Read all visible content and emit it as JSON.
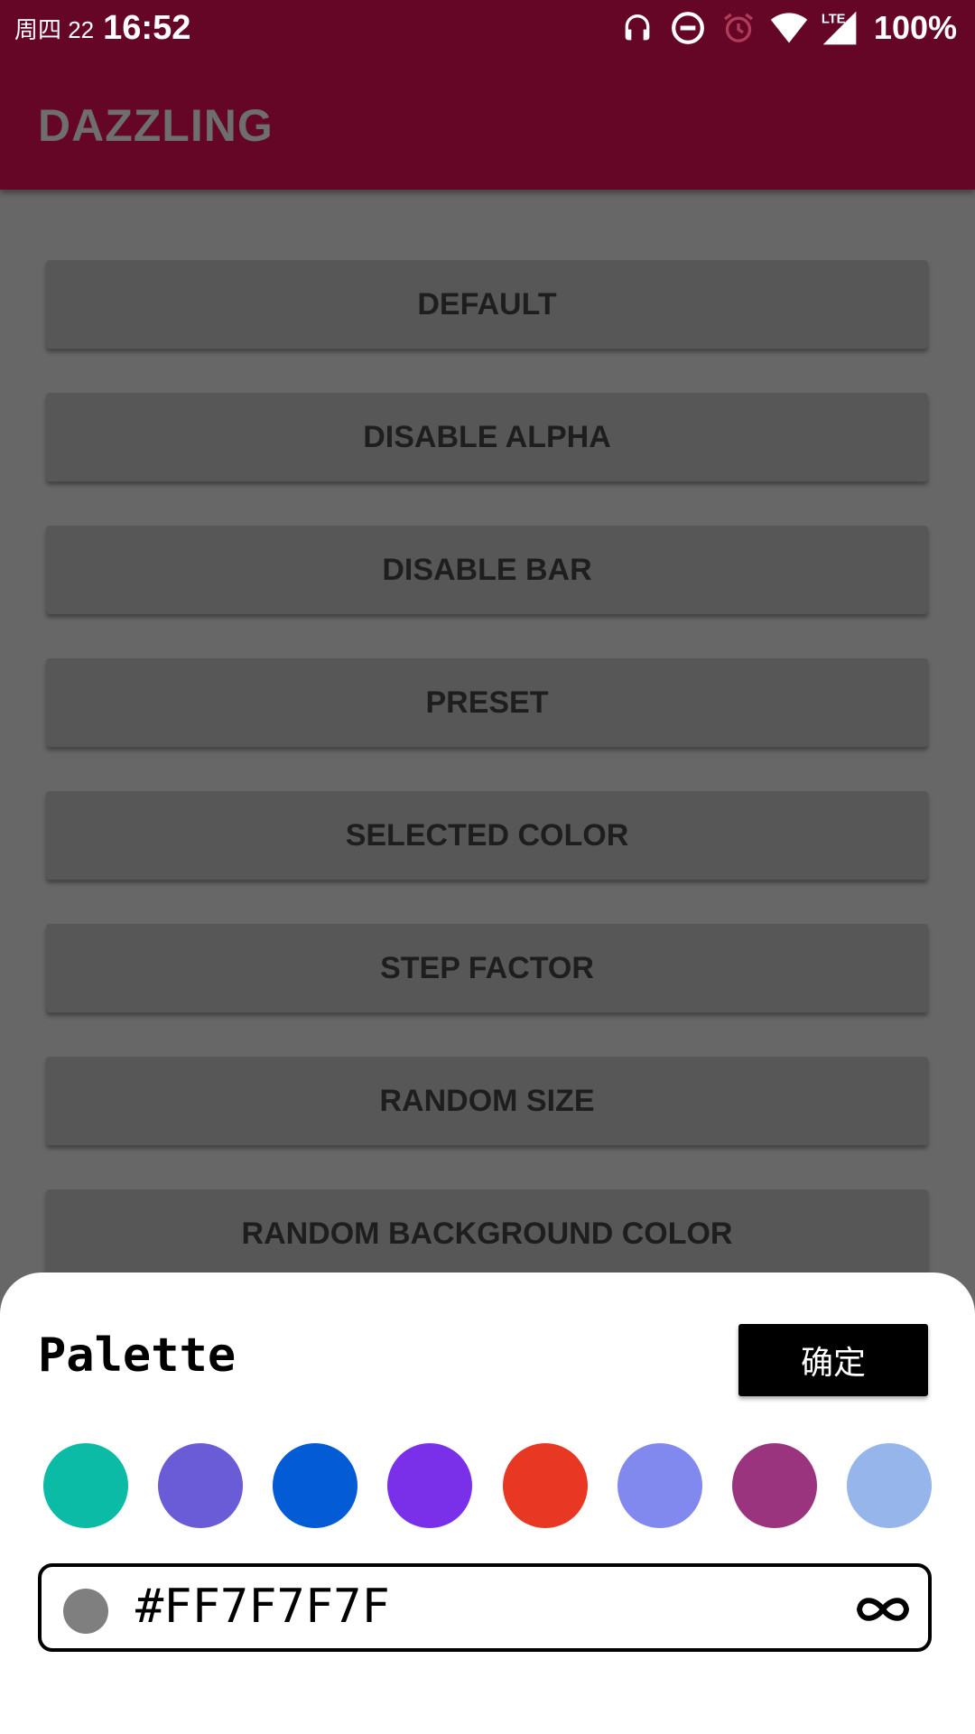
{
  "status_bar": {
    "date": "周四 22",
    "time": "16:52",
    "battery": "100%",
    "icons": [
      "headphones-icon",
      "do-not-disturb-icon",
      "alarm-icon",
      "wifi-icon",
      "lte-signal-icon"
    ]
  },
  "app_bar": {
    "title": "DAZZLING"
  },
  "buttons": [
    "DEFAULT",
    "DISABLE ALPHA",
    "DISABLE BAR",
    "PRESET",
    "SELECTED COLOR",
    "STEP FACTOR",
    "RANDOM SIZE",
    "RANDOM BACKGROUND COLOR"
  ],
  "palette": {
    "title": "Palette",
    "confirm_label": "确定",
    "swatches": [
      "#0bbba5",
      "#6a5bd6",
      "#035bd5",
      "#7a2fe8",
      "#e83824",
      "#8289ee",
      "#9a347e",
      "#96b5ea"
    ],
    "hex_value": "#FF7F7F7F",
    "current_color": "#7f7f7f",
    "link_icon": "infinity-icon"
  },
  "colors": {
    "app_bar": "#650626",
    "scrim": "#676767",
    "button": "#575757"
  }
}
